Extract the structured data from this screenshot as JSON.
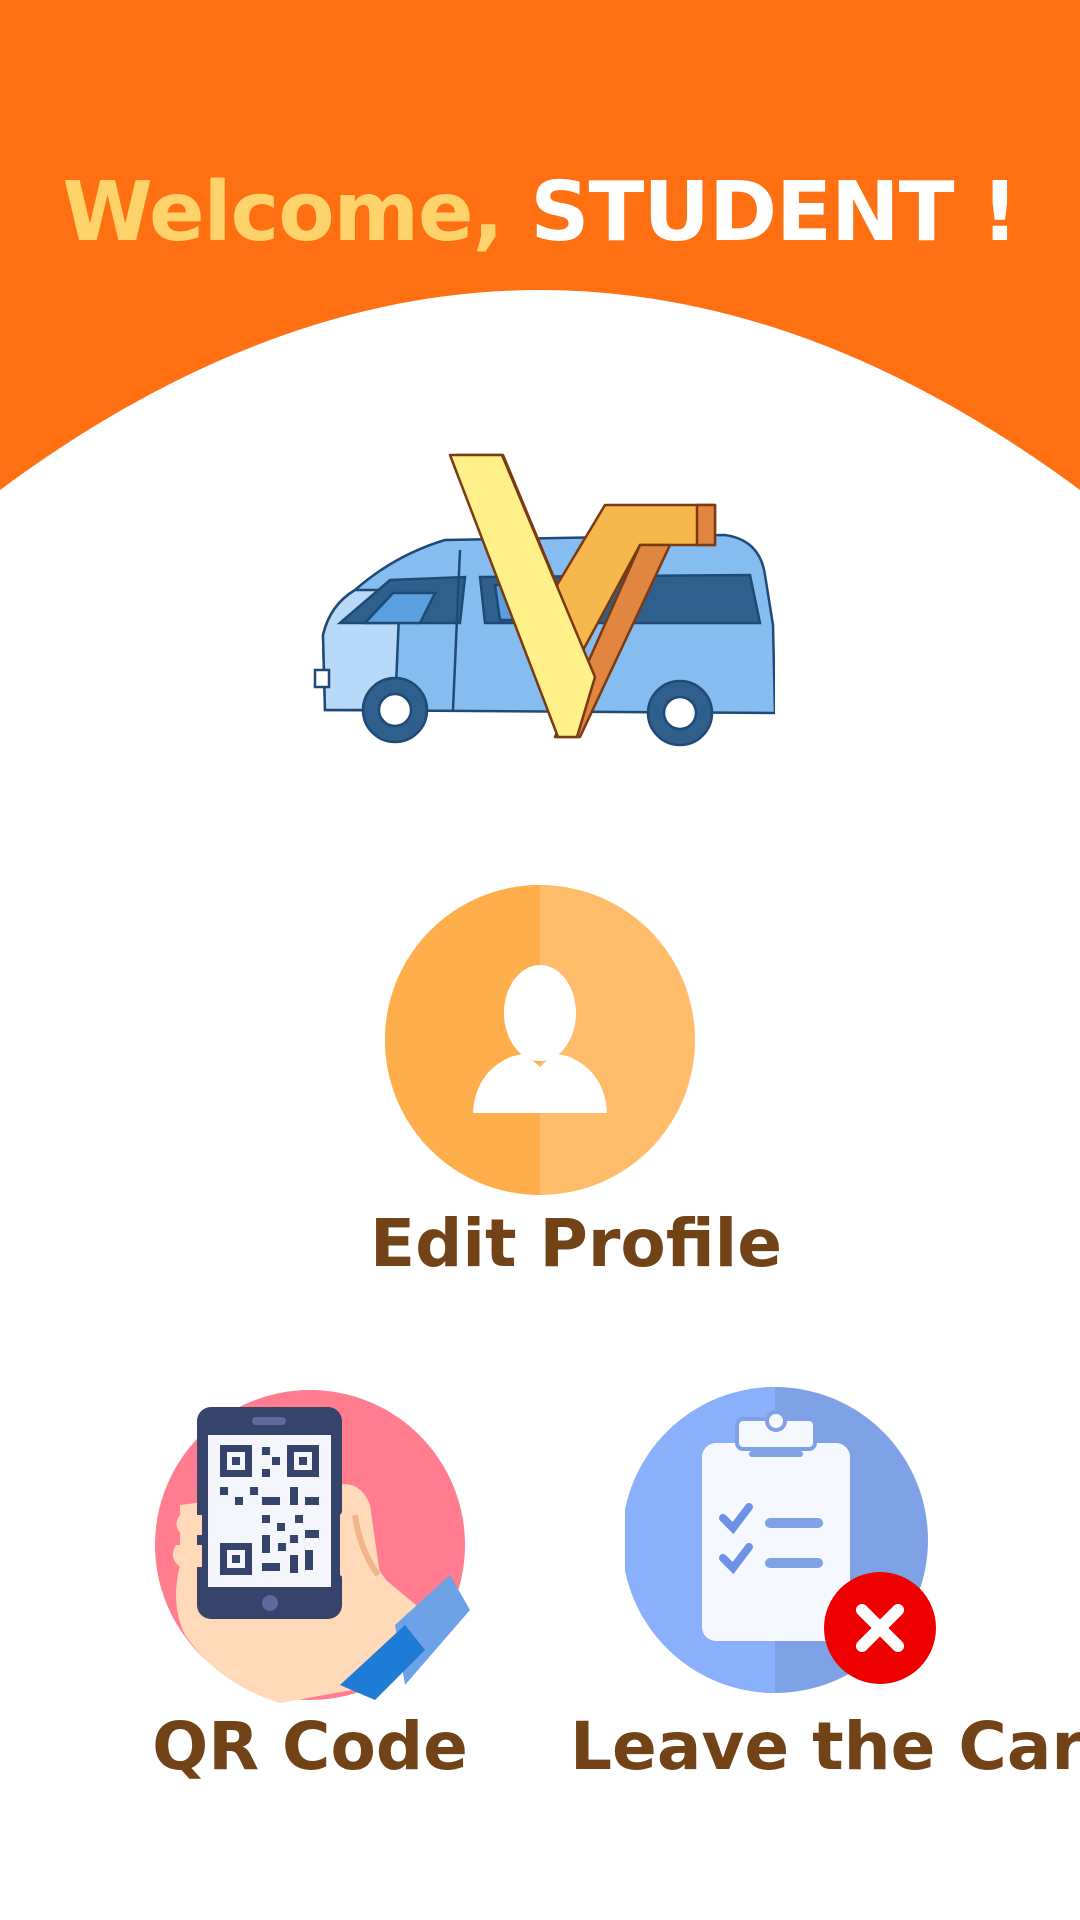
{
  "header": {
    "welcome_prefix": "Welcome,",
    "welcome_name": "STUDENT !",
    "background_color": "#ff7012",
    "prefix_color": "#ffd36b"
  },
  "logo": {
    "icon": "van-logo-icon"
  },
  "actions": {
    "edit_profile": {
      "label": "Edit Profile",
      "icon": "user-icon"
    },
    "qr_code": {
      "label": "QR Code",
      "icon": "qr-phone-icon"
    },
    "leave_car": {
      "label": "Leave the Car",
      "icon": "clipboard-cancel-icon"
    }
  },
  "colors": {
    "label_text": "#734318",
    "profile_circle": "#ffb04e",
    "qr_circle": "#ff7d8f",
    "leave_circle": "#7fa8f5",
    "cancel_badge": "#ee0000"
  }
}
